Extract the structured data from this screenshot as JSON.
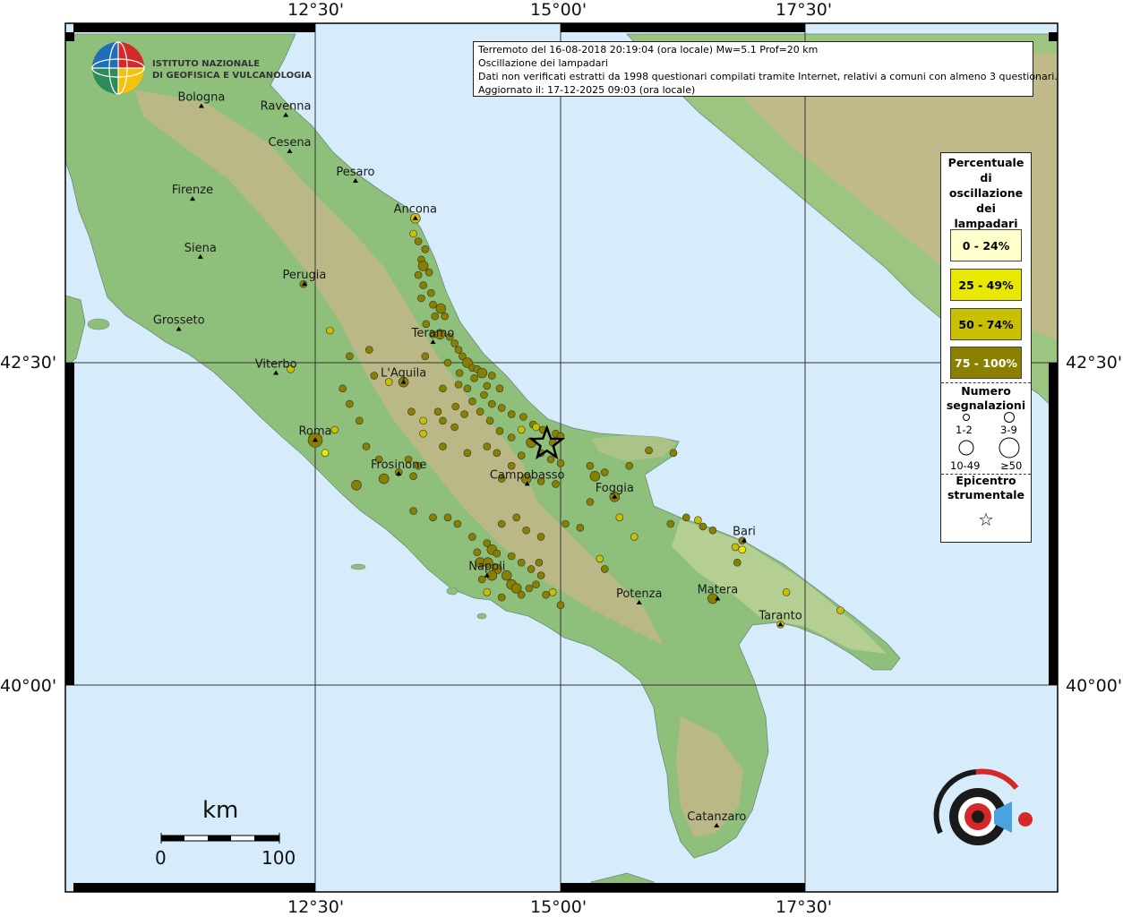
{
  "header": {
    "line1": "Terremoto del 16-08-2018 20:19:04 (ora locale) Mw=5.1 Prof=20 km",
    "line2": "Oscillazione dei lampadari",
    "line3": "Dati non verificati estratti da 1998 questionari compilati tramite Internet, relativi a comuni con almeno 3 questionari.",
    "line4": "Aggiornato il: 17-12-2025 09:03 (ora locale)"
  },
  "logo": {
    "line1": "ISTITUTO NAZIONALE",
    "line2": "DI GEOFISICA E VULCANOLOGIA"
  },
  "coords": {
    "top_1": "12°30'",
    "top_2": "15°00'",
    "top_3": "17°30'",
    "bottom_1": "12°30'",
    "bottom_2": "15°00'",
    "bottom_3": "17°30'",
    "left_1": "42°30'",
    "left_2": "40°00'",
    "right_1": "42°30'",
    "right_2": "40°00'"
  },
  "legend": {
    "title_lines": [
      "Percentuale",
      "di",
      "oscillazione",
      "dei",
      "lampadari"
    ],
    "classes": [
      {
        "label": "0 - 24%",
        "color": "#ffffcc"
      },
      {
        "label": "25 - 49%",
        "color": "#e8e800"
      },
      {
        "label": "50 - 74%",
        "color": "#c8c000"
      },
      {
        "label": "75 - 100%",
        "color": "#8a8000"
      }
    ],
    "count_title_1": "Numero",
    "count_title_2": "segnalazioni",
    "size_labels": [
      "1-2",
      "3-9",
      "10-49",
      "≥50"
    ],
    "epicenter_title_1": "Epicentro",
    "epicenter_title_2": "strumentale",
    "epicenter_symbol": "☆"
  },
  "scale": {
    "unit": "km",
    "min": "0",
    "max": "100"
  },
  "cities": [
    {
      "name": "Bologna",
      "lon": 11.34,
      "lat": 44.49
    },
    {
      "name": "Ravenna",
      "lon": 12.2,
      "lat": 44.42
    },
    {
      "name": "Cesena",
      "lon": 12.24,
      "lat": 44.14
    },
    {
      "name": "Pesaro",
      "lon": 12.91,
      "lat": 43.91
    },
    {
      "name": "Firenze",
      "lon": 11.25,
      "lat": 43.77
    },
    {
      "name": "Ancona",
      "lon": 13.52,
      "lat": 43.62
    },
    {
      "name": "Siena",
      "lon": 11.33,
      "lat": 43.32
    },
    {
      "name": "Perugia",
      "lon": 12.39,
      "lat": 43.11
    },
    {
      "name": "Grosseto",
      "lon": 11.11,
      "lat": 42.76
    },
    {
      "name": "Teramo",
      "lon": 13.7,
      "lat": 42.66
    },
    {
      "name": "Viterbo",
      "lon": 12.1,
      "lat": 42.42
    },
    {
      "name": "L'Aquila",
      "lon": 13.4,
      "lat": 42.35
    },
    {
      "name": "Roma",
      "lon": 12.5,
      "lat": 41.9
    },
    {
      "name": "Frosinone",
      "lon": 13.35,
      "lat": 41.64
    },
    {
      "name": "Campobasso",
      "lon": 14.66,
      "lat": 41.56
    },
    {
      "name": "Foggia",
      "lon": 15.55,
      "lat": 41.46
    },
    {
      "name": "Bari",
      "lon": 16.87,
      "lat": 41.12
    },
    {
      "name": "Napoli",
      "lon": 14.25,
      "lat": 40.85
    },
    {
      "name": "Potenza",
      "lon": 15.8,
      "lat": 40.64
    },
    {
      "name": "Matera",
      "lon": 16.6,
      "lat": 40.67
    },
    {
      "name": "Taranto",
      "lon": 17.24,
      "lat": 40.47
    },
    {
      "name": "Catanzaro",
      "lon": 16.59,
      "lat": 38.91
    }
  ],
  "epicenter": {
    "lon": 14.86,
    "lat": 41.87
  },
  "points": [
    [
      13.52,
      43.62,
      2,
      2
    ],
    [
      13.5,
      43.5,
      2,
      1
    ],
    [
      13.55,
      43.44,
      3,
      1
    ],
    [
      13.62,
      43.38,
      3,
      1
    ],
    [
      13.58,
      43.3,
      3,
      1
    ],
    [
      13.6,
      43.25,
      3,
      2
    ],
    [
      13.66,
      43.2,
      3,
      1
    ],
    [
      13.55,
      43.18,
      3,
      1
    ],
    [
      13.6,
      43.1,
      3,
      1
    ],
    [
      13.68,
      43.04,
      3,
      1
    ],
    [
      13.58,
      43.0,
      3,
      1
    ],
    [
      13.7,
      42.95,
      3,
      1
    ],
    [
      13.78,
      42.92,
      3,
      2
    ],
    [
      13.82,
      42.86,
      3,
      1
    ],
    [
      13.72,
      42.86,
      3,
      1
    ],
    [
      13.63,
      42.8,
      3,
      1
    ],
    [
      13.7,
      42.72,
      3,
      1
    ],
    [
      13.77,
      42.72,
      3,
      2
    ],
    [
      13.87,
      42.7,
      3,
      1
    ],
    [
      13.92,
      42.65,
      3,
      1
    ],
    [
      13.96,
      42.6,
      3,
      1
    ],
    [
      14.0,
      42.55,
      3,
      1
    ],
    [
      14.05,
      42.5,
      3,
      2
    ],
    [
      14.1,
      42.46,
      3,
      1
    ],
    [
      14.15,
      42.45,
      3,
      1
    ],
    [
      14.2,
      42.42,
      3,
      2
    ],
    [
      14.12,
      42.38,
      3,
      1
    ],
    [
      14.25,
      42.32,
      3,
      1
    ],
    [
      14.22,
      42.25,
      3,
      1
    ],
    [
      14.3,
      42.18,
      3,
      1
    ],
    [
      14.4,
      42.15,
      3,
      1
    ],
    [
      14.5,
      42.1,
      3,
      1
    ],
    [
      14.62,
      42.08,
      3,
      1
    ],
    [
      14.72,
      42.02,
      3,
      1
    ],
    [
      14.82,
      41.98,
      3,
      1
    ],
    [
      14.95,
      41.95,
      3,
      1
    ],
    [
      15.0,
      41.93,
      3,
      1
    ],
    [
      13.62,
      42.55,
      3,
      1
    ],
    [
      13.85,
      42.5,
      3,
      1
    ],
    [
      13.97,
      42.42,
      3,
      1
    ],
    [
      13.96,
      42.33,
      3,
      1
    ],
    [
      14.05,
      42.3,
      3,
      1
    ],
    [
      14.1,
      42.2,
      3,
      1
    ],
    [
      14.02,
      42.1,
      3,
      1
    ],
    [
      13.92,
      42.0,
      3,
      1
    ],
    [
      13.8,
      42.05,
      3,
      1
    ],
    [
      14.18,
      42.12,
      3,
      1
    ],
    [
      14.28,
      42.05,
      3,
      1
    ],
    [
      14.38,
      41.97,
      3,
      1
    ],
    [
      14.5,
      41.92,
      3,
      1
    ],
    [
      14.6,
      41.98,
      2,
      1
    ],
    [
      14.7,
      41.88,
      3,
      2
    ],
    [
      14.8,
      41.8,
      3,
      1
    ],
    [
      14.9,
      41.75,
      3,
      1
    ],
    [
      15.0,
      41.72,
      3,
      1
    ],
    [
      14.6,
      41.78,
      3,
      1
    ],
    [
      14.5,
      41.7,
      3,
      1
    ],
    [
      14.4,
      41.6,
      3,
      1
    ],
    [
      14.65,
      41.6,
      3,
      2
    ],
    [
      14.8,
      41.58,
      3,
      1
    ],
    [
      14.95,
      41.56,
      3,
      1
    ],
    [
      15.3,
      41.7,
      3,
      1
    ],
    [
      15.45,
      41.65,
      3,
      1
    ],
    [
      15.35,
      41.62,
      3,
      2
    ],
    [
      15.55,
      41.46,
      3,
      2
    ],
    [
      15.3,
      41.42,
      3,
      1
    ],
    [
      15.7,
      41.7,
      3,
      1
    ],
    [
      15.9,
      41.82,
      3,
      1
    ],
    [
      16.15,
      41.8,
      3,
      1
    ],
    [
      16.12,
      41.25,
      3,
      1
    ],
    [
      16.28,
      41.3,
      3,
      1
    ],
    [
      16.4,
      41.28,
      2,
      1
    ],
    [
      16.45,
      41.23,
      3,
      1
    ],
    [
      16.55,
      41.2,
      3,
      1
    ],
    [
      16.85,
      41.12,
      3,
      1
    ],
    [
      16.78,
      41.07,
      2,
      1
    ],
    [
      16.85,
      41.05,
      1,
      1
    ],
    [
      16.8,
      40.95,
      3,
      1
    ],
    [
      16.55,
      40.67,
      3,
      2
    ],
    [
      17.24,
      40.47,
      2,
      1
    ],
    [
      17.3,
      40.72,
      2,
      1
    ],
    [
      17.85,
      40.58,
      2,
      1
    ],
    [
      15.4,
      40.98,
      2,
      1
    ],
    [
      15.45,
      40.9,
      3,
      1
    ],
    [
      15.75,
      41.15,
      2,
      1
    ],
    [
      15.6,
      41.3,
      2,
      1
    ],
    [
      15.2,
      41.22,
      3,
      1
    ],
    [
      15.05,
      41.25,
      3,
      1
    ],
    [
      14.8,
      41.15,
      3,
      1
    ],
    [
      14.65,
      41.2,
      3,
      1
    ],
    [
      14.55,
      41.3,
      3,
      1
    ],
    [
      14.4,
      41.25,
      3,
      1
    ],
    [
      14.25,
      41.1,
      3,
      1
    ],
    [
      14.3,
      41.05,
      3,
      2
    ],
    [
      14.15,
      41.03,
      3,
      1
    ],
    [
      14.18,
      40.95,
      3,
      2
    ],
    [
      14.26,
      40.95,
      3,
      2
    ],
    [
      14.35,
      40.9,
      3,
      2
    ],
    [
      14.3,
      40.85,
      3,
      2
    ],
    [
      14.2,
      40.82,
      3,
      1
    ],
    [
      14.45,
      40.85,
      3,
      2
    ],
    [
      14.5,
      40.78,
      3,
      2
    ],
    [
      14.55,
      40.75,
      3,
      2
    ],
    [
      14.6,
      40.7,
      3,
      1
    ],
    [
      14.68,
      40.75,
      3,
      1
    ],
    [
      14.75,
      40.78,
      3,
      1
    ],
    [
      14.85,
      40.7,
      3,
      1
    ],
    [
      14.92,
      40.72,
      2,
      1
    ],
    [
      15.0,
      40.62,
      3,
      1
    ],
    [
      14.4,
      40.68,
      3,
      1
    ],
    [
      14.25,
      40.72,
      2,
      1
    ],
    [
      14.78,
      40.95,
      3,
      1
    ],
    [
      14.6,
      40.95,
      3,
      1
    ],
    [
      14.7,
      40.9,
      3,
      1
    ],
    [
      14.8,
      40.85,
      3,
      1
    ],
    [
      14.5,
      41.0,
      3,
      1
    ],
    [
      14.35,
      41.02,
      3,
      1
    ],
    [
      14.1,
      41.15,
      3,
      1
    ],
    [
      13.95,
      41.25,
      3,
      1
    ],
    [
      13.85,
      41.3,
      3,
      1
    ],
    [
      13.7,
      41.3,
      3,
      1
    ],
    [
      13.5,
      41.35,
      3,
      1
    ],
    [
      13.35,
      41.65,
      3,
      1
    ],
    [
      13.5,
      41.62,
      3,
      1
    ],
    [
      13.55,
      41.7,
      3,
      1
    ],
    [
      13.2,
      41.6,
      3,
      2
    ],
    [
      12.92,
      41.55,
      3,
      2
    ],
    [
      13.02,
      41.85,
      3,
      1
    ],
    [
      12.5,
      41.9,
      3,
      3
    ],
    [
      12.6,
      41.8,
      1,
      1
    ],
    [
      12.7,
      41.98,
      2,
      1
    ],
    [
      12.85,
      42.18,
      3,
      1
    ],
    [
      12.95,
      42.05,
      3,
      1
    ],
    [
      13.15,
      41.75,
      3,
      1
    ],
    [
      13.45,
      41.75,
      3,
      1
    ],
    [
      13.1,
      42.4,
      3,
      1
    ],
    [
      13.4,
      42.35,
      3,
      2
    ],
    [
      12.78,
      42.3,
      3,
      1
    ],
    [
      12.85,
      42.55,
      3,
      1
    ],
    [
      13.25,
      42.35,
      2,
      1
    ],
    [
      12.25,
      42.45,
      2,
      1
    ],
    [
      12.65,
      42.75,
      2,
      1
    ],
    [
      13.05,
      42.6,
      3,
      1
    ],
    [
      13.6,
      41.95,
      2,
      1
    ],
    [
      13.8,
      41.85,
      3,
      1
    ],
    [
      14.05,
      41.8,
      3,
      1
    ],
    [
      14.25,
      41.85,
      3,
      1
    ],
    [
      14.35,
      41.8,
      3,
      1
    ],
    [
      14.75,
      42.0,
      2,
      1
    ],
    [
      14.92,
      41.88,
      3,
      1
    ],
    [
      13.6,
      42.05,
      2,
      1
    ],
    [
      13.75,
      42.12,
      3,
      1
    ],
    [
      13.93,
      42.16,
      3,
      1
    ],
    [
      13.48,
      42.12,
      3,
      1
    ],
    [
      14.38,
      42.3,
      3,
      1
    ],
    [
      14.3,
      42.4,
      3,
      1
    ],
    [
      13.8,
      42.3,
      3,
      1
    ],
    [
      12.38,
      43.11,
      3,
      1
    ]
  ]
}
